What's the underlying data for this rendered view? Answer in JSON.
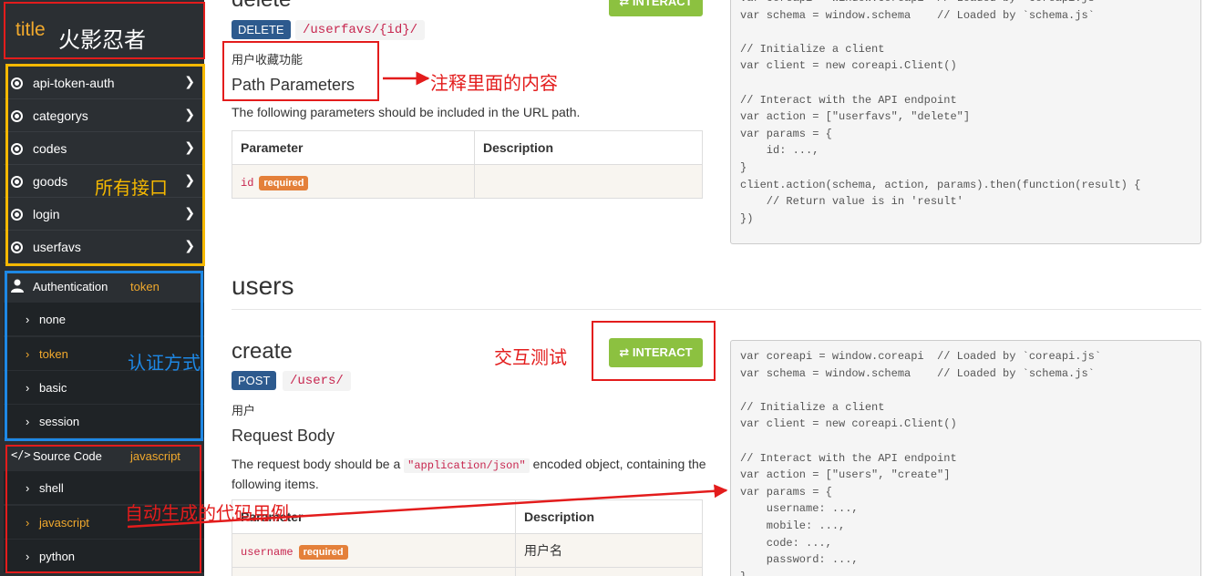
{
  "sidebar": {
    "brand_title": "title",
    "brand_name": "火影忍者",
    "endpoints": [
      {
        "label": "api-token-auth"
      },
      {
        "label": "categorys"
      },
      {
        "label": "codes"
      },
      {
        "label": "goods"
      },
      {
        "label": "login"
      },
      {
        "label": "userfavs"
      }
    ],
    "auth": {
      "label": "Authentication",
      "value": "token",
      "options": [
        "none",
        "token",
        "basic",
        "session"
      ]
    },
    "source": {
      "label": "Source Code",
      "value": "javascript",
      "options": [
        "shell",
        "javascript",
        "python"
      ]
    }
  },
  "content": {
    "delete_section": {
      "title": "delete",
      "method": "DELETE",
      "path": "/userfavs/{id}/",
      "interact_label": "⇄ INTERACT",
      "description": "用户收藏功能",
      "subheading": "Path Parameters",
      "note": "The following parameters should be included in the URL path.",
      "table_headers": [
        "Parameter",
        "Description"
      ],
      "rows": [
        {
          "name": "id",
          "badge": "required",
          "desc": ""
        }
      ],
      "code": "var coreapi = window.coreapi  // Loaded by `coreapi.js`\nvar schema = window.schema    // Loaded by `schema.js`\n\n// Initialize a client\nvar client = new coreapi.Client()\n\n// Interact with the API endpoint\nvar action = [\"userfavs\", \"delete\"]\nvar params = {\n    id: ...,\n}\nclient.action(schema, action, params).then(function(result) {\n    // Return value is in 'result'\n})"
    },
    "group_title": "users",
    "create_section": {
      "title": "create",
      "method": "POST",
      "path": "/users/",
      "interact_label": "⇄ INTERACT",
      "description": "用户",
      "subheading": "Request Body",
      "note_pre": "The request body should be a",
      "note_code": "\"application/json\"",
      "note_post": "encoded object, containing the",
      "note_line2": "following items.",
      "table_headers": [
        "Parameter",
        "Description"
      ],
      "rows": [
        {
          "name": "username",
          "badge": "required",
          "desc": "用户名"
        }
      ],
      "code": "var coreapi = window.coreapi  // Loaded by `coreapi.js`\nvar schema = window.schema    // Loaded by `schema.js`\n\n// Initialize a client\nvar client = new coreapi.Client()\n\n// Interact with the API endpoint\nvar action = [\"users\", \"create\"]\nvar params = {\n    username: ...,\n    mobile: ...,\n    code: ...,\n    password: ...,\n}"
    }
  },
  "annotations": {
    "comment_content": "注释里面的内容",
    "all_interfaces": "所有接口",
    "auth_methods": "认证方式",
    "interactive_test": "交互测试",
    "code_examples": "自动生成的代码用例"
  },
  "colors": {
    "sidebar_bg": "#2b2f33",
    "accent_orange": "#f1a92d",
    "method_blue": "#2d5a8e",
    "interact_green": "#8cc140",
    "annotation_red": "#e31c1c",
    "annotation_yellow": "#f5b800",
    "annotation_blue": "#1e88e5"
  }
}
